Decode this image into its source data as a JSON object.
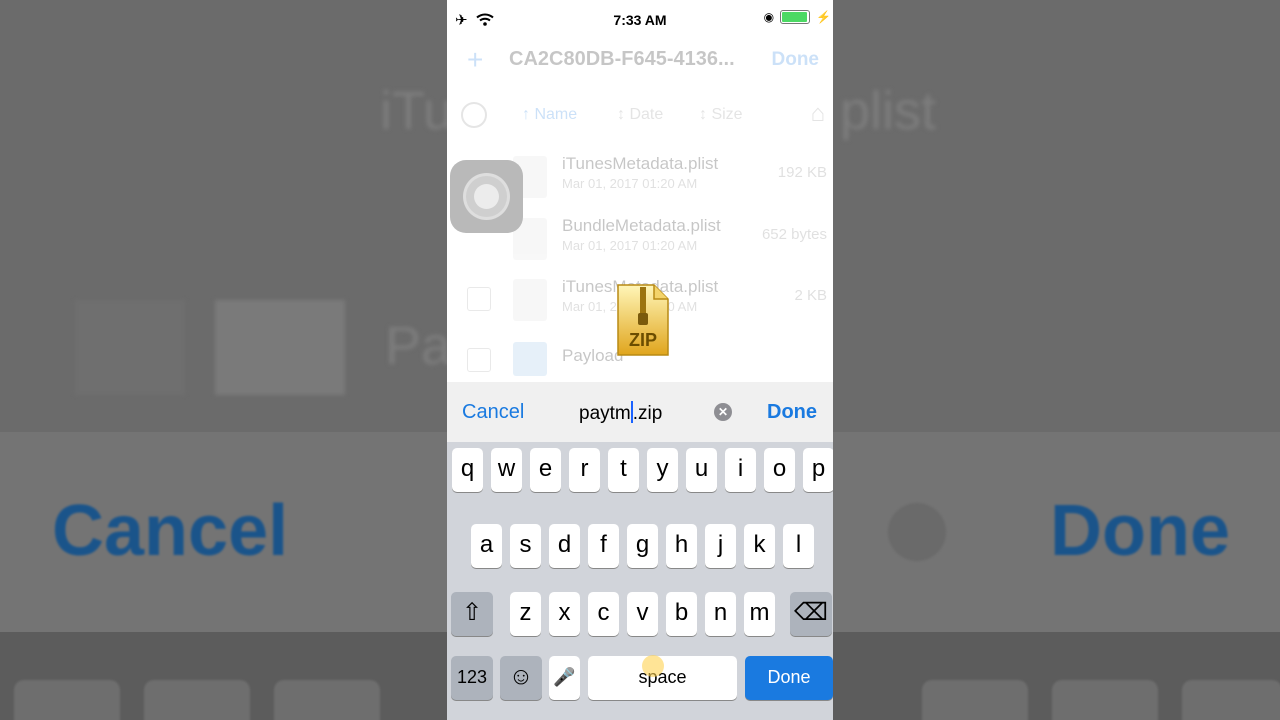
{
  "status": {
    "time": "7:33 AM",
    "battery_color": "#4cd964"
  },
  "nav": {
    "plus": "+",
    "title": "CA2C80DB-F645-4136...",
    "done": "Done"
  },
  "sort": {
    "name": "Name",
    "date": "Date",
    "size": "Size"
  },
  "files": [
    {
      "name": "iTunesMetadata.plist",
      "date": "Mar 01, 2017 01:20 AM",
      "size": "192 KB"
    },
    {
      "name": "BundleMetadata.plist",
      "date": "Mar 01, 2017 01:20 AM",
      "size": "652 bytes"
    },
    {
      "name": "iTunesMetadata.plist",
      "date": "Mar 01, 2017 01:20 AM",
      "size": "2 KB"
    },
    {
      "name": "Payload",
      "date": "",
      "size": ""
    }
  ],
  "zip": {
    "label": "ZIP"
  },
  "rename": {
    "cancel": "Cancel",
    "value_before_caret": "paytm",
    "value_after_caret": ".zip",
    "clear_symbol": "✕",
    "done": "Done"
  },
  "keyboard": {
    "row1": [
      "q",
      "w",
      "e",
      "r",
      "t",
      "y",
      "u",
      "i",
      "o",
      "p"
    ],
    "row2": [
      "a",
      "s",
      "d",
      "f",
      "g",
      "h",
      "j",
      "k",
      "l"
    ],
    "row3": [
      "z",
      "x",
      "c",
      "v",
      "b",
      "n",
      "m"
    ],
    "shift": "⇧",
    "delete": "⌫",
    "numbers": "123",
    "emoji": "☺",
    "mic": "🎤",
    "space": "space",
    "done": "Done"
  },
  "backdrop": {
    "cancel": "Cancel",
    "done": "Done",
    "it": "iTu",
    "plist": "plist",
    "pa": "Pa"
  },
  "colors": {
    "accent": "#1a7ae0",
    "keyboard_bg": "#d1d4da"
  }
}
